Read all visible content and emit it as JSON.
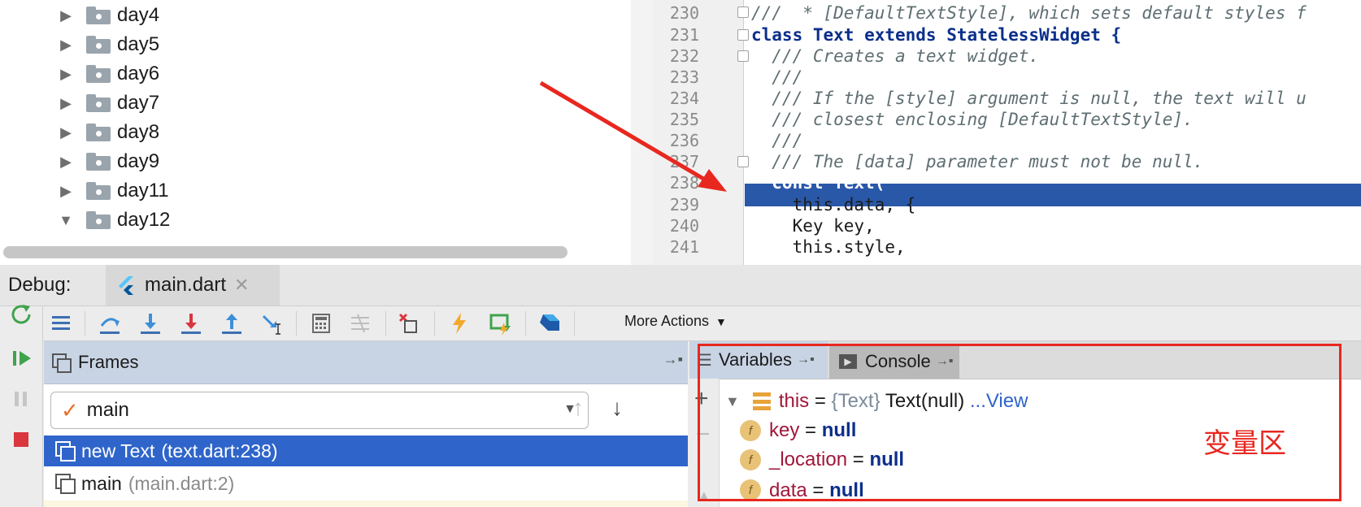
{
  "tree": {
    "items": [
      {
        "label": "day4",
        "expanded": false
      },
      {
        "label": "day5",
        "expanded": false
      },
      {
        "label": "day6",
        "expanded": false
      },
      {
        "label": "day7",
        "expanded": false
      },
      {
        "label": "day8",
        "expanded": false
      },
      {
        "label": "day9",
        "expanded": false
      },
      {
        "label": "day11",
        "expanded": false
      },
      {
        "label": "day12",
        "expanded": true
      }
    ]
  },
  "editor": {
    "line_numbers": [
      "230",
      "231",
      "232",
      "233",
      "234",
      "235",
      "236",
      "237",
      "238",
      "239",
      "240",
      "241"
    ],
    "lines": [
      "///  * [DefaultTextStyle], which sets default styles f",
      "class Text extends StatelessWidget {",
      "  /// Creates a text widget.",
      "  ///",
      "  /// If the [style] argument is null, the text will u",
      "  /// closest enclosing [DefaultTextStyle].",
      "  ///",
      "  /// The [data] parameter must not be null.",
      "  const Text(",
      "    this.data, {",
      "    Key key,",
      "    this.style,"
    ],
    "current_line": "238"
  },
  "debug": {
    "label": "Debug:",
    "tab_label": "main.dart",
    "more_actions": "More Actions"
  },
  "frames": {
    "title": "Frames",
    "thread": "main",
    "items": [
      {
        "name": "new Text",
        "location": "(text.dart:238)"
      },
      {
        "name": "main",
        "location": "(main.dart:2)"
      }
    ]
  },
  "variables": {
    "tab_variables": "Variables",
    "tab_console": "Console",
    "root": {
      "name": "this",
      "eq": " = ",
      "type": "{Text}",
      "value": " Text(null)",
      "view": " ...View"
    },
    "fields": [
      {
        "name": "key",
        "value": "null"
      },
      {
        "name": "_location",
        "value": "null"
      },
      {
        "name": "data",
        "value": "null"
      }
    ]
  },
  "annotation": {
    "label": "变量区",
    "color": "#e8271f"
  },
  "colors": {
    "selection": "#2f65ca",
    "panel_header": "#c8d4e4",
    "keyword": "#0b2f8a"
  }
}
